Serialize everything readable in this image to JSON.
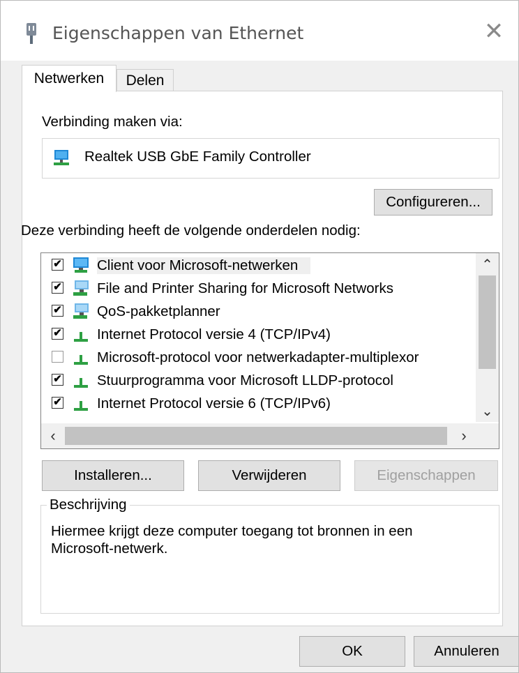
{
  "window": {
    "title": "Eigenschappen van Ethernet",
    "close_label": "✕"
  },
  "tabs": [
    {
      "label": "Netwerken",
      "active": true
    },
    {
      "label": "Delen",
      "active": false
    }
  ],
  "connection": {
    "label": "Verbinding maken via:",
    "adapter_name": "Realtek USB GbE Family Controller",
    "adapter_icon": "network-adapter-icon",
    "configure_label": "Configureren..."
  },
  "components": {
    "label": "Deze verbinding heeft de volgende onderdelen nodig:",
    "items": [
      {
        "label": "Client voor Microsoft-netwerken",
        "checked": true,
        "icon": "network-client-icon",
        "selected": true
      },
      {
        "label": "File and Printer Sharing for Microsoft Networks",
        "checked": true,
        "icon": "network-service-icon",
        "selected": false
      },
      {
        "label": "QoS-pakketplanner",
        "checked": true,
        "icon": "network-service-icon",
        "selected": false
      },
      {
        "label": "Internet Protocol versie 4 (TCP/IPv4)",
        "checked": true,
        "icon": "protocol-icon",
        "selected": false
      },
      {
        "label": "Microsoft-protocol voor netwerkadapter-multiplexor",
        "checked": false,
        "icon": "protocol-icon",
        "selected": false
      },
      {
        "label": "Stuurprogramma voor Microsoft LLDP-protocol",
        "checked": true,
        "icon": "protocol-icon",
        "selected": false
      },
      {
        "label": "Internet Protocol versie 6 (TCP/IPv6)",
        "checked": true,
        "icon": "protocol-icon",
        "selected": false
      }
    ]
  },
  "buttons": {
    "install": "Installeren...",
    "remove": "Verwijderen",
    "properties": "Eigenschappen"
  },
  "description": {
    "legend": "Beschrijving",
    "text": "Hiermee krijgt deze computer toegang tot bronnen in een Microsoft-netwerk."
  },
  "footer": {
    "ok": "OK",
    "cancel": "Annuleren"
  },
  "colors": {
    "window_bg": "#f0f0f0",
    "panel_bg": "#ffffff",
    "disabled_text": "#a0a0a0",
    "icon_blue": "#1e88d6",
    "icon_green": "#2ea043"
  }
}
